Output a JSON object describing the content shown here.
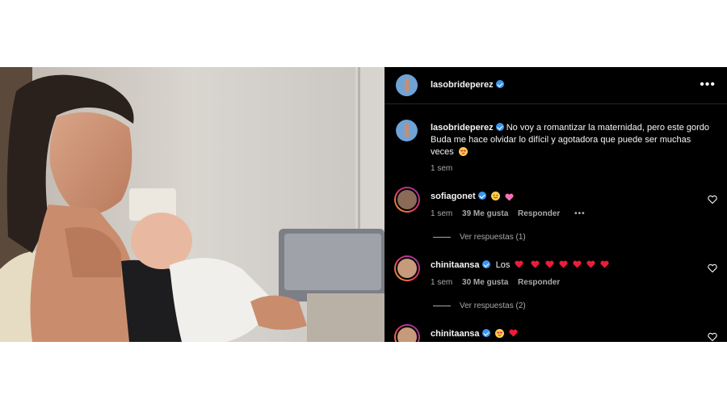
{
  "post": {
    "author": "lasobrideperez",
    "caption": "No voy a romantizar la maternidad, pero este gordo Buda me hace olvidar lo difícil y agotadora que puede ser muchas veces",
    "caption_time": "1 sem",
    "more_label": "•••"
  },
  "comments": [
    {
      "user": "sofiagonet",
      "text": "",
      "time": "1 sem",
      "likes": "39 Me gusta",
      "reply": "Responder",
      "more": "•••",
      "view_replies": "Ver respuestas (1)"
    },
    {
      "user": "chinitaansa",
      "text": "Los",
      "time": "1 sem",
      "likes": "30 Me gusta",
      "reply": "Responder",
      "view_replies": "Ver respuestas (2)"
    },
    {
      "user": "chinitaansa",
      "text": ""
    }
  ],
  "colors": {
    "background": "#000000",
    "text": "#f5f5f5",
    "muted": "#a8a8a8",
    "verified": "#3897f0",
    "heart": "#ed1c3a"
  }
}
